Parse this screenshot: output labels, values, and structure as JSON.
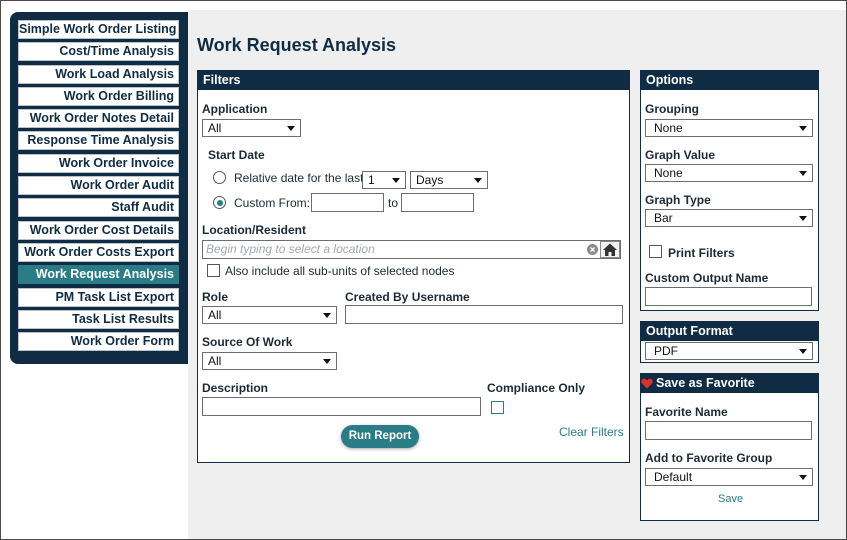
{
  "sidebar": {
    "items": [
      {
        "label": "Simple Work Order Listing",
        "active": false
      },
      {
        "label": "Cost/Time Analysis",
        "active": false
      },
      {
        "label": "Work Load Analysis",
        "active": false
      },
      {
        "label": "Work Order Billing",
        "active": false
      },
      {
        "label": "Work Order Notes Detail",
        "active": false
      },
      {
        "label": "Response Time Analysis",
        "active": false
      },
      {
        "label": "Work Order Invoice",
        "active": false
      },
      {
        "label": "Work Order Audit",
        "active": false
      },
      {
        "label": "Staff Audit",
        "active": false
      },
      {
        "label": "Work Order Cost Details",
        "active": false
      },
      {
        "label": "Work Order Costs Export",
        "active": false
      },
      {
        "label": "Work Request Analysis",
        "active": true
      },
      {
        "label": "PM Task List Export",
        "active": false
      },
      {
        "label": "Task List Results",
        "active": false
      },
      {
        "label": "Work Order Form",
        "active": false
      }
    ]
  },
  "page": {
    "title": "Work Request Analysis"
  },
  "filters": {
    "header": "Filters",
    "application": {
      "label": "Application",
      "value": "All"
    },
    "start_date": {
      "label": "Start Date",
      "relative_label": "Relative date for the last",
      "relative_count": "1",
      "relative_unit": "Days",
      "custom_label": "Custom From:",
      "to_label": "to",
      "selected": "custom",
      "custom_from_value": "",
      "custom_to_value": ""
    },
    "location": {
      "label": "Location/Resident",
      "placeholder": "Begin typing to select a location",
      "include_subunits_label": "Also include all sub-units of selected nodes",
      "include_subunits_checked": false
    },
    "role": {
      "label": "Role",
      "value": "All"
    },
    "created_by": {
      "label": "Created By Username",
      "value": ""
    },
    "source_of_work": {
      "label": "Source Of Work",
      "value": "All"
    },
    "description": {
      "label": "Description",
      "value": ""
    },
    "compliance_only": {
      "label": "Compliance Only",
      "checked": false
    },
    "run_label": "Run Report",
    "clear_label": "Clear Filters"
  },
  "options": {
    "header": "Options",
    "grouping": {
      "label": "Grouping",
      "value": "None"
    },
    "graph_value": {
      "label": "Graph Value",
      "value": "None"
    },
    "graph_type": {
      "label": "Graph Type",
      "value": "Bar"
    },
    "print_filters": {
      "label": "Print Filters",
      "checked": false
    },
    "custom_output": {
      "label": "Custom Output Name",
      "value": ""
    }
  },
  "output_format": {
    "header": "Output Format",
    "value": "PDF"
  },
  "favorite": {
    "header": "Save as Favorite",
    "name_label": "Favorite Name",
    "name_value": "",
    "group_label": "Add to Favorite Group",
    "group_value": "Default",
    "save_label": "Save"
  },
  "colors": {
    "navy": "#0f2c44",
    "teal": "#2a7d86",
    "heart": "#d9322f"
  }
}
